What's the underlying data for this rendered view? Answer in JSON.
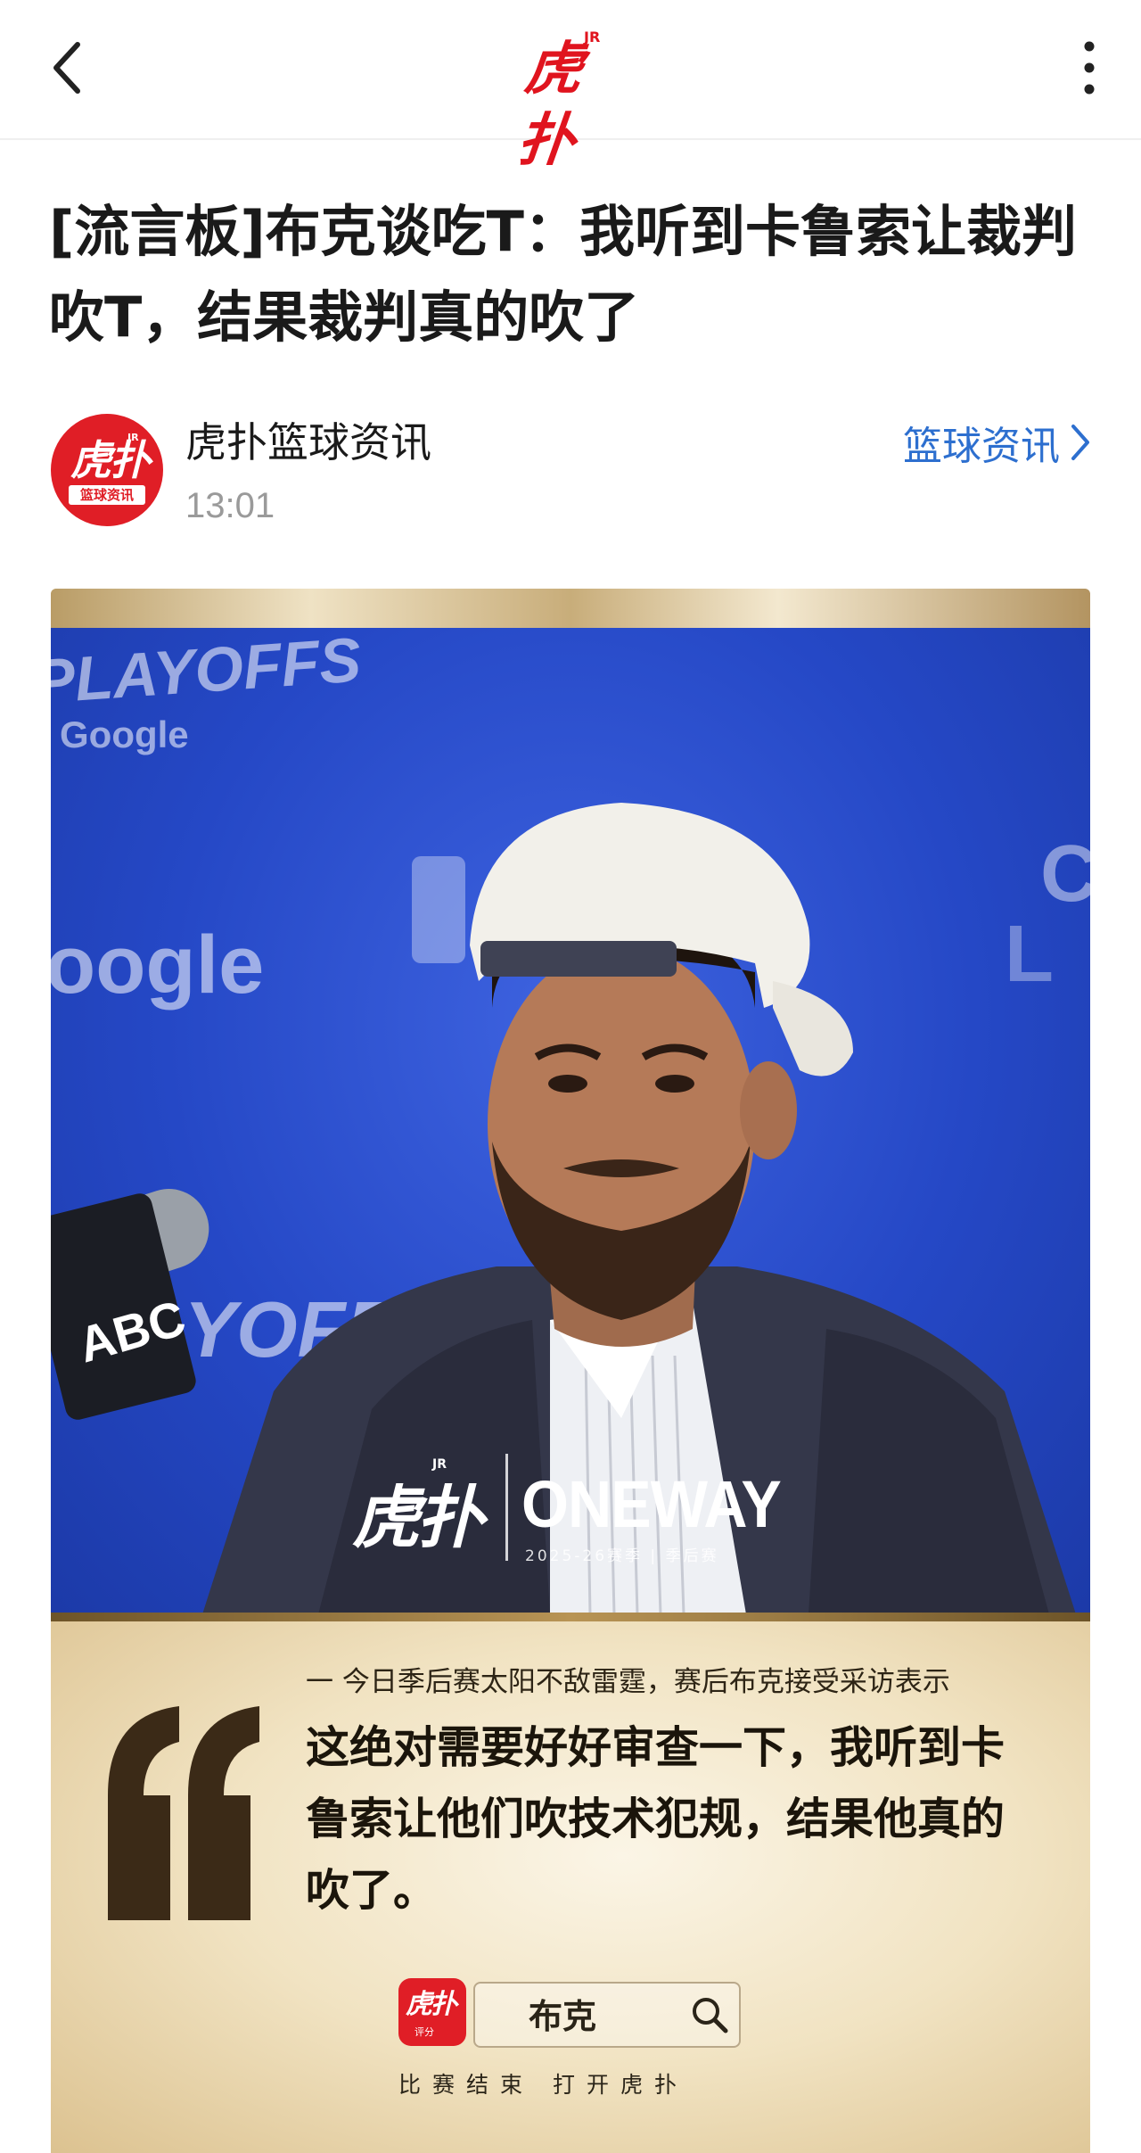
{
  "header": {
    "logo_text": "虎扑",
    "logo_jr": "JR"
  },
  "article": {
    "title": "[流言板]布克谈吃T：我听到卡鲁索让裁判吹T，结果裁判真的吹了",
    "author": {
      "name": "虎扑篮球资讯",
      "avatar_text": "虎扑",
      "avatar_jr": "JR",
      "avatar_sub": "篮球资讯",
      "time": "13:01"
    },
    "category": "篮球资讯"
  },
  "image": {
    "bg_texts": [
      "PLAYOFFS",
      "Google",
      "oogle",
      "PLAYOFFS"
    ],
    "mic_label": "ABC",
    "overlay": {
      "hupu": "虎扑",
      "jr": "JR",
      "oneway": "ONEWAY",
      "season": "2025-26赛季 | 季后赛"
    },
    "quote_intro": "一 今日季后赛太阳不敌雷霆，赛后布克接受采访表示",
    "quote_text": "这绝对需要好好审查一下，我听到卡鲁索让他们吹技术犯规，结果他真的吹了。",
    "search_widget": {
      "logo_text": "虎扑",
      "logo_sub": "评分",
      "query": "布克",
      "caption": "比赛结束 打开虎扑"
    }
  },
  "colors": {
    "brand_red": "#e0141e",
    "link_blue": "#2d6fcf",
    "time_gray": "#9a9a9a",
    "photo_blue": "#2548c6",
    "gold": "#dcc290"
  }
}
